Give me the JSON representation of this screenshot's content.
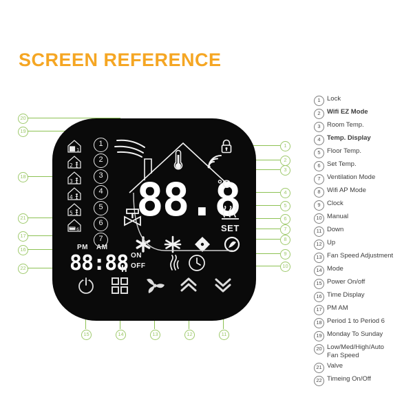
{
  "page": {
    "title": "SCREEN REFERENCE",
    "title_color": "#F5A623",
    "background": "#ffffff"
  },
  "device": {
    "name": "wifi-thermostat-lcd",
    "body_color": "#0a0a0a",
    "lcd_color": "#f2f2f2",
    "callout_color": "#8cc152",
    "display": {
      "main_temp": "88.8",
      "unit": "°C",
      "set_label": "SET",
      "time_value": "88:88",
      "hour_suffix": "h",
      "pm_label": "PM",
      "am_label": "AM",
      "on_label": "ON",
      "off_label": "OFF"
    },
    "period_icons": [
      {
        "num": "1",
        "name": "period-1-icon"
      },
      {
        "num": "2",
        "name": "period-2-icon"
      },
      {
        "num": "3",
        "name": "period-3-icon"
      },
      {
        "num": "4",
        "name": "period-4-icon"
      },
      {
        "num": "5",
        "name": "period-5-icon"
      },
      {
        "num": "6",
        "name": "period-6-icon"
      }
    ],
    "pointer_numbers_on_lcd": [
      "1",
      "2",
      "3",
      "4",
      "5",
      "6",
      "7"
    ],
    "status_icons": [
      {
        "name": "fan-speed-waves-icon"
      },
      {
        "name": "lock-icon"
      },
      {
        "name": "wifi-signal-icon"
      },
      {
        "name": "house-outline-icon"
      },
      {
        "name": "thermometer-icon"
      },
      {
        "name": "heat-waves-icon"
      },
      {
        "name": "valve-icon"
      },
      {
        "name": "snowflake-icon"
      },
      {
        "name": "sun-icon"
      },
      {
        "name": "fan-blade-icon"
      },
      {
        "name": "ventilation-icon"
      },
      {
        "name": "flame-icon"
      },
      {
        "name": "clock-icon"
      }
    ],
    "buttons": [
      {
        "name": "power-button",
        "icon": "power-icon"
      },
      {
        "name": "mode-button",
        "icon": "grid-icon"
      },
      {
        "name": "fan-speed-button",
        "icon": "fan-icon"
      },
      {
        "name": "up-button",
        "icon": "chevron-up-icon"
      },
      {
        "name": "down-button",
        "icon": "chevron-down-icon"
      }
    ]
  },
  "callouts": {
    "left": [
      "20",
      "19",
      "18",
      "21",
      "17",
      "16",
      "22"
    ],
    "right": [
      "1",
      "2",
      "3",
      "4",
      "5",
      "6",
      "7",
      "8",
      "9",
      "10"
    ],
    "bottom": [
      "15",
      "14",
      "13",
      "12",
      "11"
    ]
  },
  "legend": {
    "items": [
      {
        "num": "1",
        "label": "Lock",
        "bold": false
      },
      {
        "num": "2",
        "label": "Wifi EZ Mode",
        "bold": true
      },
      {
        "num": "3",
        "label": "Room Temp.",
        "bold": false
      },
      {
        "num": "4",
        "label": "Temp. Display",
        "bold": true
      },
      {
        "num": "5",
        "label": "Floor Temp.",
        "bold": false
      },
      {
        "num": "6",
        "label": "Set Temp.",
        "bold": false
      },
      {
        "num": "7",
        "label": "Ventilation Mode",
        "bold": false
      },
      {
        "num": "8",
        "label": "Wifi AP Mode",
        "bold": false
      },
      {
        "num": "9",
        "label": "Clock",
        "bold": false
      },
      {
        "num": "10",
        "label": "Manual",
        "bold": false
      },
      {
        "num": "11",
        "label": "Down",
        "bold": false
      },
      {
        "num": "12",
        "label": "Up",
        "bold": false
      },
      {
        "num": "13",
        "label": "Fan Speed Adjustment",
        "bold": false
      },
      {
        "num": "14",
        "label": "Mode",
        "bold": false
      },
      {
        "num": "15",
        "label": "Power On/off",
        "bold": false
      },
      {
        "num": "16",
        "label": "Time Display",
        "bold": false
      },
      {
        "num": "17",
        "label": "PM  AM",
        "bold": false
      },
      {
        "num": "18",
        "label": "Period 1 to Period 6",
        "bold": false
      },
      {
        "num": "19",
        "label": "Monday To Sunday",
        "bold": false
      },
      {
        "num": "20",
        "label": "Low/Med/High/Auto\nFan Speed",
        "bold": false
      },
      {
        "num": "21",
        "label": "Valve",
        "bold": false
      },
      {
        "num": "22",
        "label": "Timeing On/Off",
        "bold": false
      }
    ]
  }
}
